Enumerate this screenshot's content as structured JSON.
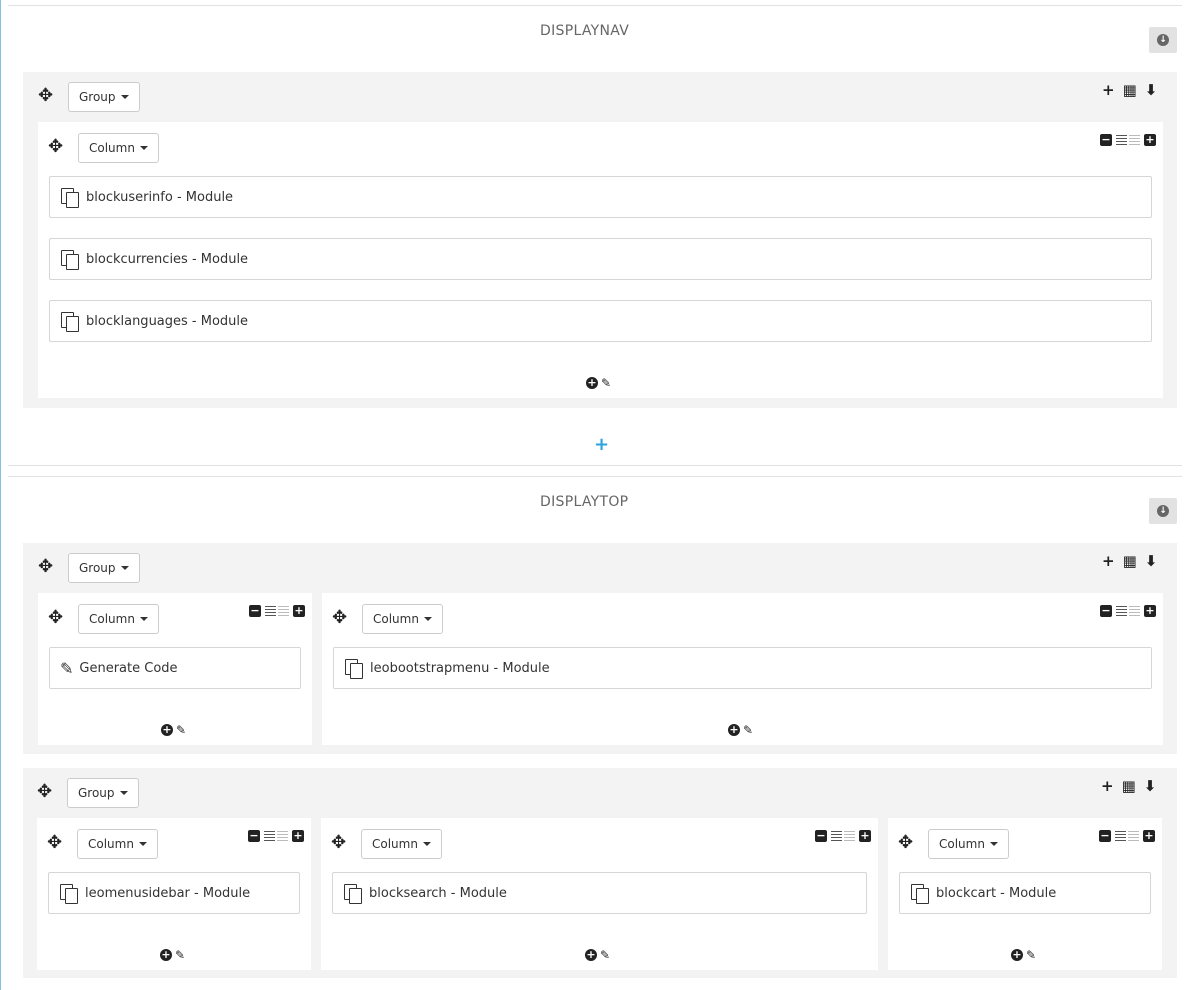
{
  "hooks": [
    {
      "title": "DISPLAYNAV",
      "group_label": "Group",
      "columns": [
        {
          "label": "Column",
          "modules": [
            "blockuserinfo - Module",
            "blockcurrencies - Module",
            "blocklanguages - Module"
          ]
        }
      ]
    },
    {
      "title": "DISPLAYTOP",
      "groups": [
        {
          "label": "Group",
          "columns": [
            {
              "label": "Column",
              "modules": [
                "Generate Code"
              ]
            },
            {
              "label": "Column",
              "modules": [
                "leobootstrapmenu - Module"
              ]
            }
          ]
        },
        {
          "label": "Group",
          "columns": [
            {
              "label": "Column",
              "modules": [
                "leomenusidebar - Module"
              ]
            },
            {
              "label": "Column",
              "modules": [
                "blocksearch - Module"
              ]
            },
            {
              "label": "Column",
              "modules": [
                "blockcart - Module"
              ]
            }
          ]
        }
      ]
    }
  ],
  "icons": {
    "move": "✥",
    "add": "+",
    "grid": "▦",
    "collapse": "⬇",
    "minus": "−",
    "plus": "+",
    "edit": "✎"
  },
  "colors": {
    "accent": "#2aa3dd",
    "group_bg": "#f3f3f3"
  }
}
